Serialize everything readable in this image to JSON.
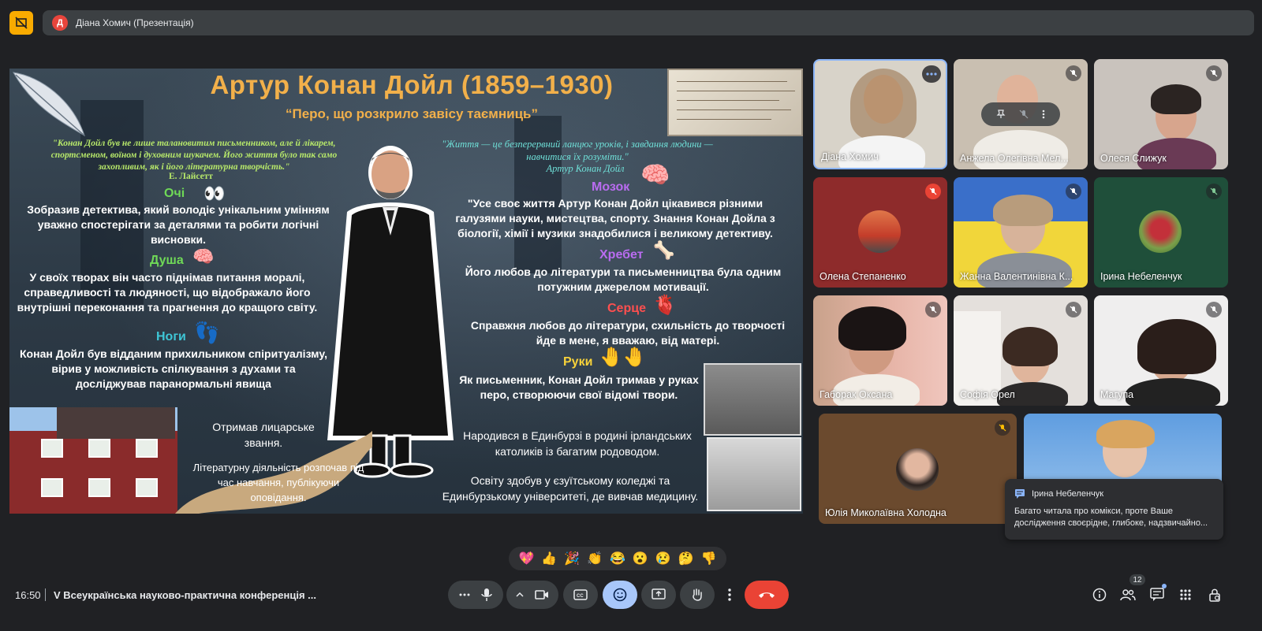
{
  "presenter_bar": {
    "initial": "Д",
    "label": "Діана Хомич (Презентація)"
  },
  "slide": {
    "title": "Артур Конан Дойл (1859–1930)",
    "subtitle": "“Перо, що розкрило завісу таємниць”",
    "quote_left": "\"Конан Дойл був не лише талановитим письменником, але й лікарем, спортсменом, воїном і духовним шукачем. Його життя було так само захопливим, як і його літературна творчість.\"",
    "quote_left_author": "Е. Лайсетт",
    "quote_right": "\"Життя — це безперервний ланцюг уроків, і завдання людини — навчитися їх розуміти.\"",
    "quote_right_author": "Артур Конан Дойл",
    "sections": {
      "eyes_label": "Очі",
      "eyes_text": "Зобразив детектива, який володіє унікальним умінням уважно спостерігати за деталями та робити логічні висновки.",
      "soul_label": "Душа",
      "soul_text": "У своїх творах він часто піднімав питання моралі, справедливості та людяності, що відображало його внутрішні переконання та прагнення до кращого світу.",
      "legs_label": "Ноги",
      "legs_text": "Конан Дойл був відданим прихильником спіритуалізму, вірив у можливість спілкування з духами та досліджував паранормальні явища",
      "brain_label": "Мозок",
      "brain_text": "\"Усе своє життя Артур Конан Дойл цікавився різними галузями науки, мистецтва, спорту. Знання Конан Дойла з біології, хімії і музики знадобилися і великому детективу.",
      "spine_label": "Хребет",
      "spine_text": "Його любов до літератури та письменництва була одним потужним джерелом мотивації.",
      "heart_label": "Серце",
      "heart_text": "Справжня любов до літератури, схильність до творчості йде в мене, я вважаю, від матері.",
      "hands_label": "Руки",
      "hands_text": "Як письменник, Конан Дойл тримав у руках перо, створюючи свої відомі твори."
    },
    "knight_text": "Отримав лицарське звання.",
    "literary_text": "Літературну діяльність розпочав під час навчання, публікуючи оповідання.",
    "born_text": "Народився в Единбурзі в родині ірландських католиків із багатим родоводом.",
    "education_text": "Освіту здобув у єзуїтському коледжі та Единбурзькому університеті, де вивчав медицину."
  },
  "participants": [
    {
      "name": "Діана Хомич"
    },
    {
      "name": "Анжела Олегівна Мел..."
    },
    {
      "name": "Олеся Слижук"
    },
    {
      "name": "Олена Степаненко"
    },
    {
      "name": "Жанна Валентинівна К..."
    },
    {
      "name": "Ірина Небеленчук"
    },
    {
      "name": "Габорак Оксана"
    },
    {
      "name": "Софія Орел"
    },
    {
      "name": "Магупа"
    },
    {
      "name": "Юлія Миколаївна Холодна"
    },
    {
      "name": ""
    }
  ],
  "chat_notification": {
    "sender": "Ірина Небеленчук",
    "message": "Багато читала про комікси, проте Ваше дослідження своєрідне, глибоке, надзвичайно..."
  },
  "reactions": [
    "💖",
    "👍",
    "🎉",
    "👏",
    "😂",
    "😮",
    "😢",
    "🤔",
    "👎"
  ],
  "bottom_bar": {
    "time": "16:50",
    "meeting_title": "V Всеукраїнська науково-практична конференція ...",
    "people_count": "12"
  },
  "colors": {
    "accent_yellow": "#f9ab00",
    "end_call_red": "#ea4335",
    "active_blue": "#a8c7fa",
    "bg": "#202124"
  }
}
